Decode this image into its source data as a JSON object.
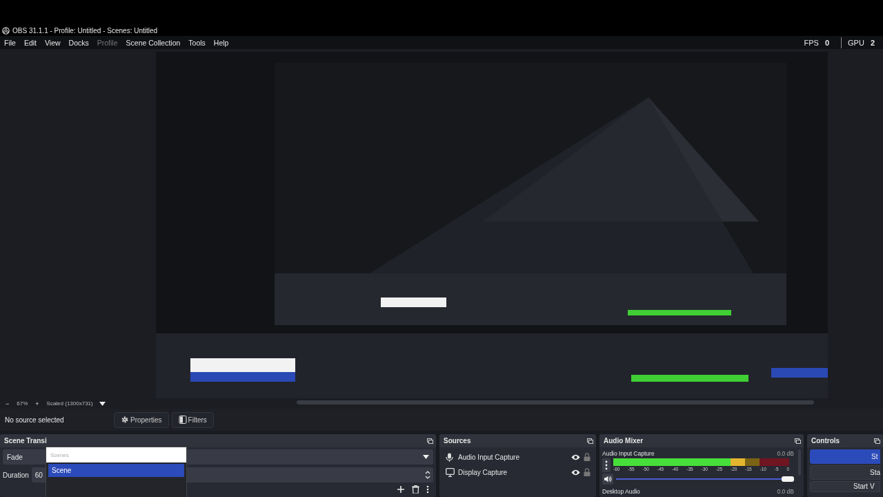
{
  "window": {
    "title": "OBS 31.1.1 - Profile: Untitled - Scenes: Untitled"
  },
  "menu": [
    {
      "label": "File",
      "disabled": false
    },
    {
      "label": "Edit",
      "disabled": false
    },
    {
      "label": "View",
      "disabled": false
    },
    {
      "label": "Docks",
      "disabled": false
    },
    {
      "label": "Profile",
      "disabled": true
    },
    {
      "label": "Scene Collection",
      "disabled": false
    },
    {
      "label": "Tools",
      "disabled": false
    },
    {
      "label": "Help",
      "disabled": false
    }
  ],
  "stats": [
    {
      "label": "FPS",
      "value": "0"
    },
    {
      "label": "GPU",
      "value": "2"
    }
  ],
  "zoom_bar": {
    "minus": "−",
    "zoom": "67%",
    "plus": "+",
    "scale_mode": "Scaled (1300x731)"
  },
  "context_bar": {
    "status": "No source selected",
    "buttons": [
      {
        "label": "Properties",
        "kind": "properties"
      },
      {
        "label": "Filters",
        "kind": "filters"
      }
    ]
  },
  "scene_transitions": {
    "title": "Scene Transi",
    "transition": "Fade",
    "duration_label": "Duration",
    "duration": "60"
  },
  "scenes_popup": {
    "placeholder": "Scenes",
    "items": [
      {
        "label": "Scene",
        "selected": true
      }
    ]
  },
  "sources": {
    "title": "Sources",
    "items": [
      {
        "name": "Audio Input Capture",
        "kind": "audio"
      },
      {
        "name": "Display Capture",
        "kind": "display"
      }
    ]
  },
  "audio_mixer": {
    "title": "Audio Mixer",
    "ticks": [
      "-60",
      "-55",
      "-50",
      "-45",
      "-40",
      "-35",
      "-30",
      "-25",
      "-20",
      "-15",
      "-10",
      "-5",
      "0"
    ],
    "channels": [
      {
        "name": "Audio Input Capture",
        "reading": "0.0 dB",
        "meter": {
          "level": 0.75
        },
        "volume": {
          "level": 1
        }
      },
      {
        "name": "Desktop Audio",
        "reading": "0.0 dB"
      }
    ]
  },
  "controls": {
    "title": "Controls",
    "buttons": [
      {
        "label": "St",
        "primary": true
      },
      {
        "label": "Sta",
        "primary": false
      },
      {
        "label": "Start V",
        "primary": false
      }
    ]
  }
}
